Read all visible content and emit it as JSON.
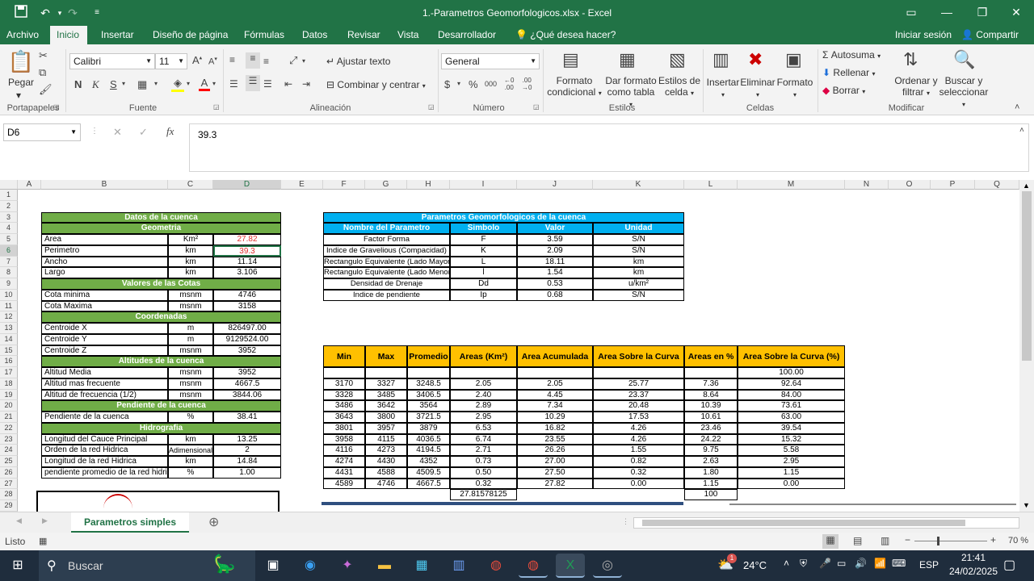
{
  "window": {
    "title": "1.-Parametros Geomorfologicos.xlsx - Excel"
  },
  "menu": {
    "tabs": [
      "Archivo",
      "Inicio",
      "Insertar",
      "Diseño de página",
      "Fórmulas",
      "Datos",
      "Revisar",
      "Vista",
      "Desarrollador",
      "¿Qué desea hacer?"
    ],
    "signin": "Iniciar sesión",
    "share": "Compartir"
  },
  "ribbon": {
    "paste": "Pegar",
    "font_name": "Calibri",
    "font_size": "11",
    "wrap_text": "Ajustar texto",
    "merge": "Combinar y centrar",
    "number_format": "General",
    "cond_format": "Formato condicional",
    "format_table": "Dar formato como tabla",
    "cell_styles": "Estilos de celda",
    "insert": "Insertar",
    "delete": "Eliminar",
    "format": "Formato",
    "autosum": "Autosuma",
    "fill": "Rellenar",
    "clear": "Borrar",
    "sort": "Ordenar y filtrar",
    "find": "Buscar y seleccionar",
    "groups": [
      "Portapapeles",
      "Fuente",
      "Alineación",
      "Número",
      "Estilos",
      "Celdas",
      "Modificar"
    ]
  },
  "formula": {
    "name_box": "D6",
    "value": "39.3"
  },
  "columns": [
    "A",
    "B",
    "C",
    "D",
    "E",
    "F",
    "G",
    "H",
    "I",
    "J",
    "K",
    "L",
    "M",
    "N",
    "O",
    "P",
    "Q"
  ],
  "rows": [
    "1",
    "2",
    "3",
    "4",
    "5",
    "6",
    "7",
    "8",
    "9",
    "10",
    "11",
    "12",
    "13",
    "14",
    "15",
    "16",
    "17",
    "18",
    "19",
    "20",
    "21",
    "22",
    "23",
    "24",
    "25",
    "26",
    "27",
    "28",
    "29"
  ],
  "left": {
    "title": "Datos de la cuenca",
    "rows": [
      {
        "type": "hdr",
        "text": "Geometria"
      },
      {
        "type": "row",
        "label": "Area",
        "unit": "Km²",
        "val": "27.82"
      },
      {
        "type": "row",
        "label": "Perimetro",
        "unit": "km",
        "val": "39.3"
      },
      {
        "type": "row",
        "label": "Ancho",
        "unit": "km",
        "val": "11.14"
      },
      {
        "type": "row",
        "label": "Largo",
        "unit": "km",
        "val": "3.106"
      },
      {
        "type": "hdr",
        "text": "Valores de las Cotas"
      },
      {
        "type": "row",
        "label": "Cota minima",
        "unit": "msnm",
        "val": "4746"
      },
      {
        "type": "row",
        "label": "Cota Maxima",
        "unit": "msnm",
        "val": "3158"
      },
      {
        "type": "hdr",
        "text": "Coordenadas"
      },
      {
        "type": "row",
        "label": "Centroide X",
        "unit": "m",
        "val": "826497.00"
      },
      {
        "type": "row",
        "label": "Centroide Y",
        "unit": "m",
        "val": "9129524.00"
      },
      {
        "type": "row",
        "label": "Centroide Z",
        "unit": "msnm",
        "val": "3952"
      },
      {
        "type": "hdr",
        "text": "Altitudes de la cuenca"
      },
      {
        "type": "row",
        "label": "Altitud Media",
        "unit": "msnm",
        "val": "3952"
      },
      {
        "type": "row",
        "label": "Altitud mas frecuente",
        "unit": "msnm",
        "val": "4667.5"
      },
      {
        "type": "row",
        "label": "Altitud de frecuencia (1/2)",
        "unit": "msnm",
        "val": "3844.06"
      },
      {
        "type": "hdr",
        "text": "Pendiente de la cuenca"
      },
      {
        "type": "row",
        "label": "Pendiente de la cuenca",
        "unit": "%",
        "val": "38.41"
      },
      {
        "type": "hdr",
        "text": "Hidrografia"
      },
      {
        "type": "row",
        "label": "Longitud del Cauce Principal",
        "unit": "km",
        "val": "13.25"
      },
      {
        "type": "row",
        "label": "Orden de la red Hidrica",
        "unit": "Adimensional",
        "val": "2"
      },
      {
        "type": "row",
        "label": "Longitud de la red Hidrica",
        "unit": "km",
        "val": "14.84"
      },
      {
        "type": "row",
        "label": "pendiente promedio de la red hidrica",
        "unit": "%",
        "val": "1.00"
      }
    ]
  },
  "params": {
    "title": "Parametros Geomorfologicos de la cuenca",
    "headers": [
      "Nombre del Parametro",
      "Simbolo",
      "Valor",
      "Unidad"
    ],
    "rows": [
      [
        "Factor Forma",
        "F",
        "3.59",
        "S/N"
      ],
      [
        "Indice de Gravelious (Compacidad)",
        "K",
        "2.09",
        "S/N"
      ],
      [
        "Rectangulo Equivalente (Lado Mayor)",
        "L",
        "18.11",
        "km"
      ],
      [
        "Rectangulo Equivalente (Lado Menor)",
        "l",
        "1.54",
        "km"
      ],
      [
        "Densidad de Drenaje",
        "Dd",
        "0.53",
        "u/km²"
      ],
      [
        "Indice de pendiente",
        "Ip",
        "0.68",
        "S/N"
      ]
    ]
  },
  "areas": {
    "headers": [
      "Min",
      "Max",
      "Promedio",
      "Areas (Km²)",
      "Area Acumulada",
      "Area Sobre la Curva",
      "Areas en %",
      "Area Sobre la Curva (%)"
    ],
    "first": [
      "",
      "",
      "",
      "",
      "",
      "",
      "",
      "100.00"
    ],
    "rows": [
      [
        "3170",
        "3327",
        "3248.5",
        "2.05",
        "2.05",
        "25.77",
        "7.36",
        "92.64"
      ],
      [
        "3328",
        "3485",
        "3406.5",
        "2.40",
        "4.45",
        "23.37",
        "8.64",
        "84.00"
      ],
      [
        "3486",
        "3642",
        "3564",
        "2.89",
        "7.34",
        "20.48",
        "10.39",
        "73.61"
      ],
      [
        "3643",
        "3800",
        "3721.5",
        "2.95",
        "10.29",
        "17.53",
        "10.61",
        "63.00"
      ],
      [
        "3801",
        "3957",
        "3879",
        "6.53",
        "16.82",
        "4.26",
        "23.46",
        "39.54"
      ],
      [
        "3958",
        "4115",
        "4036.5",
        "6.74",
        "23.55",
        "4.26",
        "24.22",
        "15.32"
      ],
      [
        "4116",
        "4273",
        "4194.5",
        "2.71",
        "26.26",
        "1.55",
        "9.75",
        "5.58"
      ],
      [
        "4274",
        "4430",
        "4352",
        "0.73",
        "27.00",
        "0.82",
        "2.63",
        "2.95"
      ],
      [
        "4431",
        "4588",
        "4509.5",
        "0.50",
        "27.50",
        "0.32",
        "1.80",
        "1.15"
      ],
      [
        "4589",
        "4746",
        "4667.5",
        "0.32",
        "27.82",
        "0.00",
        "1.15",
        "0.00"
      ]
    ],
    "total_area": "27.81578125",
    "total_pct": "100"
  },
  "sheet_tab": "Parametros simples",
  "status": {
    "ready": "Listo",
    "zoom": "70 %"
  },
  "taskbar": {
    "search": "Buscar",
    "temp": "24°C",
    "lang": "ESP",
    "time": "21:41",
    "date": "24/02/2025",
    "weather_badge": "1"
  },
  "colors": {
    "excel_green": "#217346",
    "table_green": "#70ad47",
    "cyan": "#00b0f0",
    "gold": "#ffc000"
  }
}
